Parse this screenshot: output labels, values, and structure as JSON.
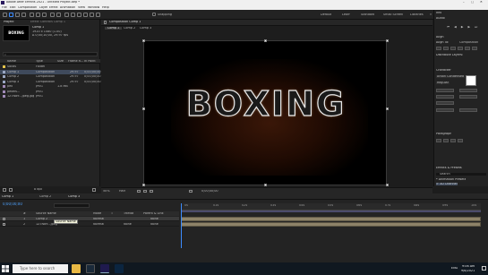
{
  "title_bar": {
    "text": "Adobe After Effects 2021 - Untitled Project.aep *"
  },
  "menu": [
    "File",
    "Edit",
    "Composition",
    "Layer",
    "Effect",
    "Animation",
    "View",
    "Window",
    "Help"
  ],
  "toolbar": {
    "snapping_label": "Snapping",
    "workspaces": [
      "Default",
      "Learn",
      "Standard",
      "Small Screen",
      "Libraries"
    ],
    "search_help": "Search Help"
  },
  "project_panel": {
    "tab": "Project",
    "effect_controls_tab": "Effect Controls Comp 1",
    "thumbnail_text": "BOXING",
    "selected_name": "Comp 1",
    "selected_info": [
      "1920 x 1080 (1.00)",
      "Δ 0;00;10;00, 29.97 fps"
    ],
    "columns": [
      "Name",
      "Type",
      "Size",
      "Frame R...",
      "In Point"
    ],
    "rows": [
      {
        "name": "Solids",
        "type": "Folder",
        "size": "",
        "fps": "",
        "in": "",
        "color": "#e4c44a"
      },
      {
        "name": "Comp 1",
        "type": "Composition",
        "size": "",
        "fps": "29.97",
        "in": "0;00;00;00",
        "color": "#9aa7c2"
      },
      {
        "name": "Comp 2",
        "type": "Composition",
        "size": "",
        "fps": "29.97",
        "in": "0;00;00;00",
        "color": "#9aa7c2"
      },
      {
        "name": "Comp 3",
        "type": "Composition",
        "size": "",
        "fps": "29.97",
        "in": "0;00;00;00",
        "color": "#9aa7c2"
      },
      {
        "name": "pex",
        "type": "JPEG",
        "size": "1.8 MB",
        "fps": "",
        "in": "",
        "color": "#a08ab7"
      },
      {
        "name": "pexels...",
        "type": "JPEG",
        "size": "",
        "fps": "",
        "in": "",
        "color": "#a08ab7"
      },
      {
        "name": "1ZTN89...jpeg.jpg",
        "type": "JPEG",
        "size": "",
        "fps": "",
        "in": "",
        "color": "#a08ab7"
      }
    ],
    "footer": "8 bpc"
  },
  "viewer": {
    "tab_label": "Composition Comp 1",
    "flow_tabs": [
      "Comp 1",
      "Comp 2",
      "Comp 3"
    ],
    "canvas_text": "BOXING",
    "zoom": "50%",
    "resolution": "Half",
    "timecode": "0;00;00;00"
  },
  "right_panel": {
    "info": "Info",
    "audio": "Audio",
    "align": "Align",
    "align_to": "Align To:",
    "align_to_value": "Composition",
    "distribute": "Distribute Layers:",
    "character": "Character",
    "font_name": "Anton Condensed",
    "font_style": "Regular",
    "paragraph": "Paragraph",
    "effects": "Effects & Presets",
    "effects_search": "Search",
    "effects_tree": [
      "* Animation Presets",
      "> 3D Channel"
    ]
  },
  "timeline": {
    "tabs": [
      "Comp 1",
      "Comp 2",
      "Comp 3"
    ],
    "current_time": "0;00;00;00",
    "columns": [
      "#",
      "Source Name",
      "Mode",
      "T",
      "TrkMat",
      "Parent & Link"
    ],
    "layers": [
      {
        "num": "1",
        "name": "Comp 2",
        "mode": "Normal",
        "trkmat": "",
        "parent": "None"
      },
      {
        "num": "2",
        "name": "1ZTN89...jpeg",
        "mode": "Normal",
        "trkmat": "None",
        "parent": "None"
      }
    ],
    "ruler_ticks": [
      "0s",
      "01s",
      "02s",
      "03s",
      "04s",
      "05s",
      "06s",
      "07s",
      "08s",
      "09s",
      "10s"
    ],
    "tooltip": "Source Name"
  },
  "taskbar": {
    "search_placeholder": "Type here to search",
    "lang": "ENG",
    "time": "9:06 AM",
    "date": "9/8/2021"
  }
}
